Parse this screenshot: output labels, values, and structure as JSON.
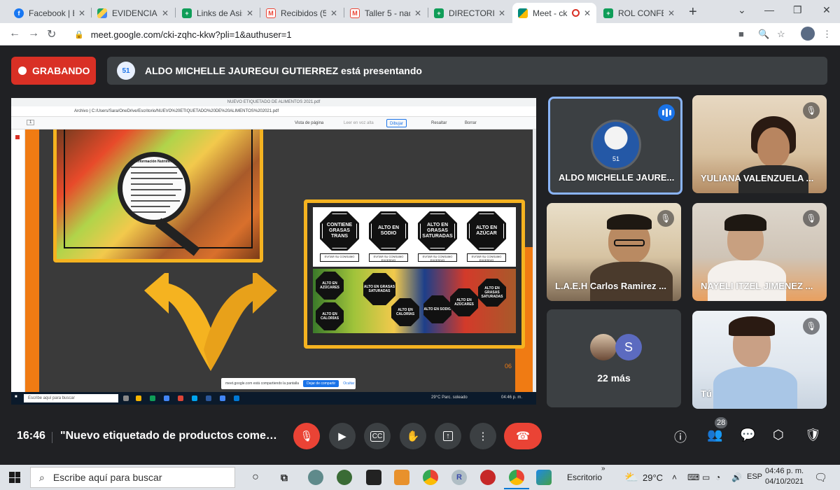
{
  "browser": {
    "tabs": [
      {
        "label": "Facebook | En",
        "icon": "facebook-icon",
        "color": "#1877f2"
      },
      {
        "label": "EVIDENCIAS D",
        "icon": "google-drive-icon",
        "color": "#1fa463"
      },
      {
        "label": "Links de Asist",
        "icon": "google-sheets-icon",
        "color": "#0f9d58"
      },
      {
        "label": "Recibidos (56",
        "icon": "gmail-icon",
        "color": "#ea4335"
      },
      {
        "label": "Taller 5 - nad",
        "icon": "gmail-icon",
        "color": "#ea4335"
      },
      {
        "label": "DIRECTORIO",
        "icon": "google-sheets-icon",
        "color": "#0f9d58"
      },
      {
        "label": "Meet - ck",
        "icon": "google-meet-icon",
        "color": "#00897b"
      },
      {
        "label": "ROL CONFERE",
        "icon": "google-sheets-icon",
        "color": "#0f9d58"
      }
    ],
    "url": "meet.google.com/cki-zqhc-kkw?pli=1&authuser=1"
  },
  "meet": {
    "recording_label": "GRABANDO",
    "presenting_text": "ALDO MICHELLE JAUREGUI GUTIERREZ está presentando",
    "time": "16:46",
    "meeting_title": "\"Nuevo etiquetado de productos comes...",
    "participants_count": "28",
    "more_count": "22 más",
    "more_initial": "S"
  },
  "participants": [
    {
      "name": "ALDO MICHELLE JAURE...",
      "speaking": true
    },
    {
      "name": "YULIANA VALENZUELA ...",
      "muted": true
    },
    {
      "name": "L.A.E.H Carlos Ramirez ...",
      "muted": true
    },
    {
      "name": "NAYELI ITZEL JIMENEZ ...",
      "muted": true
    },
    {
      "name": "Tú",
      "muted": true
    }
  ],
  "shared_screen": {
    "tab_title": "NUEVO ETIQUETADO DE ALIMENTOS 2021.pdf",
    "file_path": "Archivo | C:/Users/Sara/OneDrive/Escritorio/NUEVO%20ETIQUETADO%20DE%20ALIMENTOS%202021.pdf",
    "toolbar": {
      "page": "1",
      "page_view": "Vista de página",
      "read_aloud": "Leer en voz alta",
      "draw": "Dibujar",
      "highlight": "Resaltar",
      "erase": "Borrar"
    },
    "nutrition_title": "Información Nutrimental",
    "labels_top": [
      {
        "text": "CONTIENE GRASAS TRANS",
        "note": "EVITAR SU CONSUMO"
      },
      {
        "text": "ALTO EN SODIO",
        "note": "EVITAR SU CONSUMO EXCESIVO"
      },
      {
        "text": "ALTO EN GRASAS SATURADAS",
        "note": "EVITAR SU CONSUMO EXCESIVO"
      },
      {
        "text": "ALTO EN AZÚCAR",
        "note": "EVITAR SU CONSUMO EXCESIVO"
      }
    ],
    "labels_bottom": [
      "ALTO EN AZÚCARES",
      "ALTO EN GRASAS SATURADAS",
      "ALTO EN CALORÍAS",
      "ALTO EN CALORÍAS",
      "ALTO EN SODIO",
      "ALTO EN AZÚCARES",
      "ALTO EN GRASAS SATURADAS"
    ],
    "slide_number": "06",
    "share_notice": "meet.google.com está compartiendo la pantalla",
    "share_stop": "Dejar de compartir",
    "share_hide": "Ocultar",
    "taskbar_search": "Escribe aquí para buscar",
    "taskbar_weather": "29°C  Parc. soleado",
    "taskbar_time": "04:46 p. m."
  },
  "taskbar": {
    "search_placeholder": "Escribe aquí para buscar",
    "desktop_label": "Escritorio",
    "temperature": "29°C",
    "language": "ESP",
    "time": "04:46 p. m.",
    "date": "04/10/2021"
  },
  "colors": {
    "recording": "#d93025",
    "end_call": "#ea4335",
    "active_speaker_border": "#8ab4f8",
    "slide_orange": "#f07b13",
    "slide_gold": "#f5b320"
  }
}
